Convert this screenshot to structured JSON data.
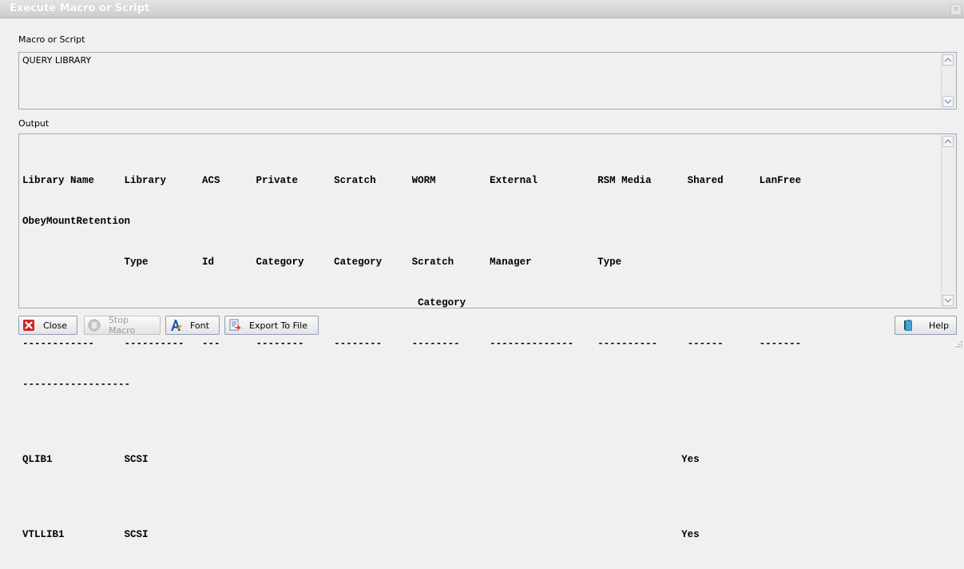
{
  "window": {
    "title": "Execute Macro or Script"
  },
  "script": {
    "label": "Macro or Script",
    "value": "QUERY LIBRARY"
  },
  "output": {
    "label": "Output",
    "lines": [
      "Library Name     Library      ACS      Private      Scratch      WORM         External          RSM Media      Shared      LanFree",
      "ObeyMountRetention",
      "                 Type         Id       Category     Category     Scratch      Manager           Type",
      "                                                                  Category",
      "------------     ----------   ---      --------     --------     --------     --------------    ----------     ------      -------",
      "------------------",
      "QLIB1            SCSI                                                                                         Yes",
      "",
      "VTLLIB1          SCSI                                                                                         Yes"
    ]
  },
  "buttons": {
    "close": "Close",
    "stop_macro": "Stop Macro",
    "font": "Font",
    "export": "Export To File",
    "help": "Help"
  },
  "icons": {
    "close": "close-red-x-icon",
    "stop_macro": "stop-hand-icon",
    "font": "font-a-icon",
    "export": "export-document-icon",
    "help": "help-book-icon"
  }
}
